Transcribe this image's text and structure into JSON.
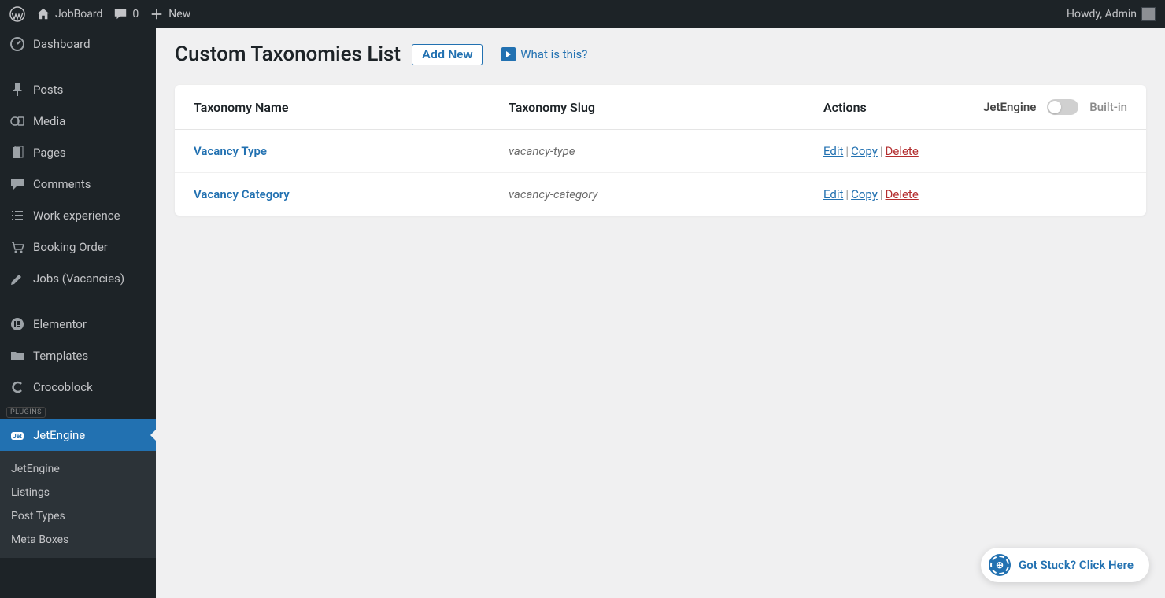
{
  "adminbar": {
    "site_name": "JobBoard",
    "comments_count": "0",
    "new_label": "New",
    "howdy": "Howdy, Admin"
  },
  "sidebar": {
    "items": [
      {
        "label": "Dashboard",
        "icon": "dashboard"
      },
      {
        "label": "Posts",
        "icon": "pin"
      },
      {
        "label": "Media",
        "icon": "media"
      },
      {
        "label": "Pages",
        "icon": "page"
      },
      {
        "label": "Comments",
        "icon": "comment"
      },
      {
        "label": "Work experience",
        "icon": "list"
      },
      {
        "label": "Booking Order",
        "icon": "cart"
      },
      {
        "label": "Jobs (Vacancies)",
        "icon": "pencil"
      }
    ],
    "items2": [
      {
        "label": "Elementor",
        "icon": "elementor"
      },
      {
        "label": "Templates",
        "icon": "folder"
      },
      {
        "label": "Crocoblock",
        "icon": "croco"
      }
    ],
    "plugins_divider": "PLUGINS",
    "jetengine": {
      "label": "JetEngine",
      "icon": "jet"
    },
    "submenu": [
      {
        "label": "JetEngine"
      },
      {
        "label": "Listings"
      },
      {
        "label": "Post Types"
      },
      {
        "label": "Meta Boxes"
      }
    ]
  },
  "page": {
    "title": "Custom Taxonomies List",
    "add_new": "Add New",
    "what_is_this": "What is this?"
  },
  "table": {
    "headers": {
      "name": "Taxonomy Name",
      "slug": "Taxonomy Slug",
      "actions": "Actions",
      "jetengine": "JetEngine",
      "builtin": "Built-in"
    },
    "actions": {
      "edit": "Edit",
      "copy": "Copy",
      "delete": "Delete"
    },
    "rows": [
      {
        "name": "Vacancy Type",
        "slug": "vacancy-type"
      },
      {
        "name": "Vacancy Category",
        "slug": "vacancy-category"
      }
    ]
  },
  "help_fab": "Got Stuck? Click Here"
}
